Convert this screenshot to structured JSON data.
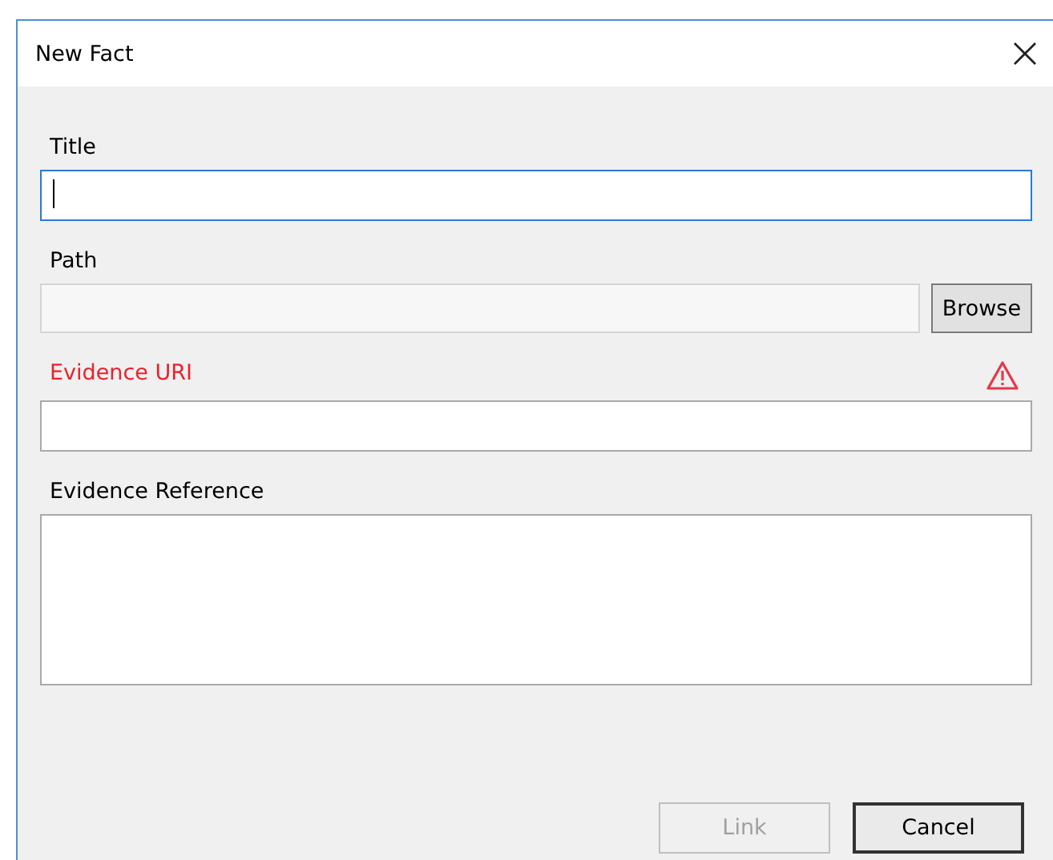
{
  "window": {
    "title": "New Fact"
  },
  "fields": [
    {
      "kind": "text",
      "label": "Title",
      "focused": true,
      "disabled": false,
      "invalid": false
    },
    {
      "kind": "browse",
      "label": "Path",
      "focused": false,
      "disabled": true,
      "invalid": false,
      "button": "Browse"
    },
    {
      "kind": "text",
      "label": "Evidence URI",
      "focused": false,
      "disabled": false,
      "invalid": true
    },
    {
      "kind": "multiline",
      "label": "Evidence Reference",
      "focused": false,
      "disabled": false,
      "invalid": false
    }
  ],
  "buttons": [
    {
      "label": "Link",
      "disabled": true,
      "default": false
    },
    {
      "label": "Cancel",
      "disabled": false,
      "default": true
    }
  ]
}
